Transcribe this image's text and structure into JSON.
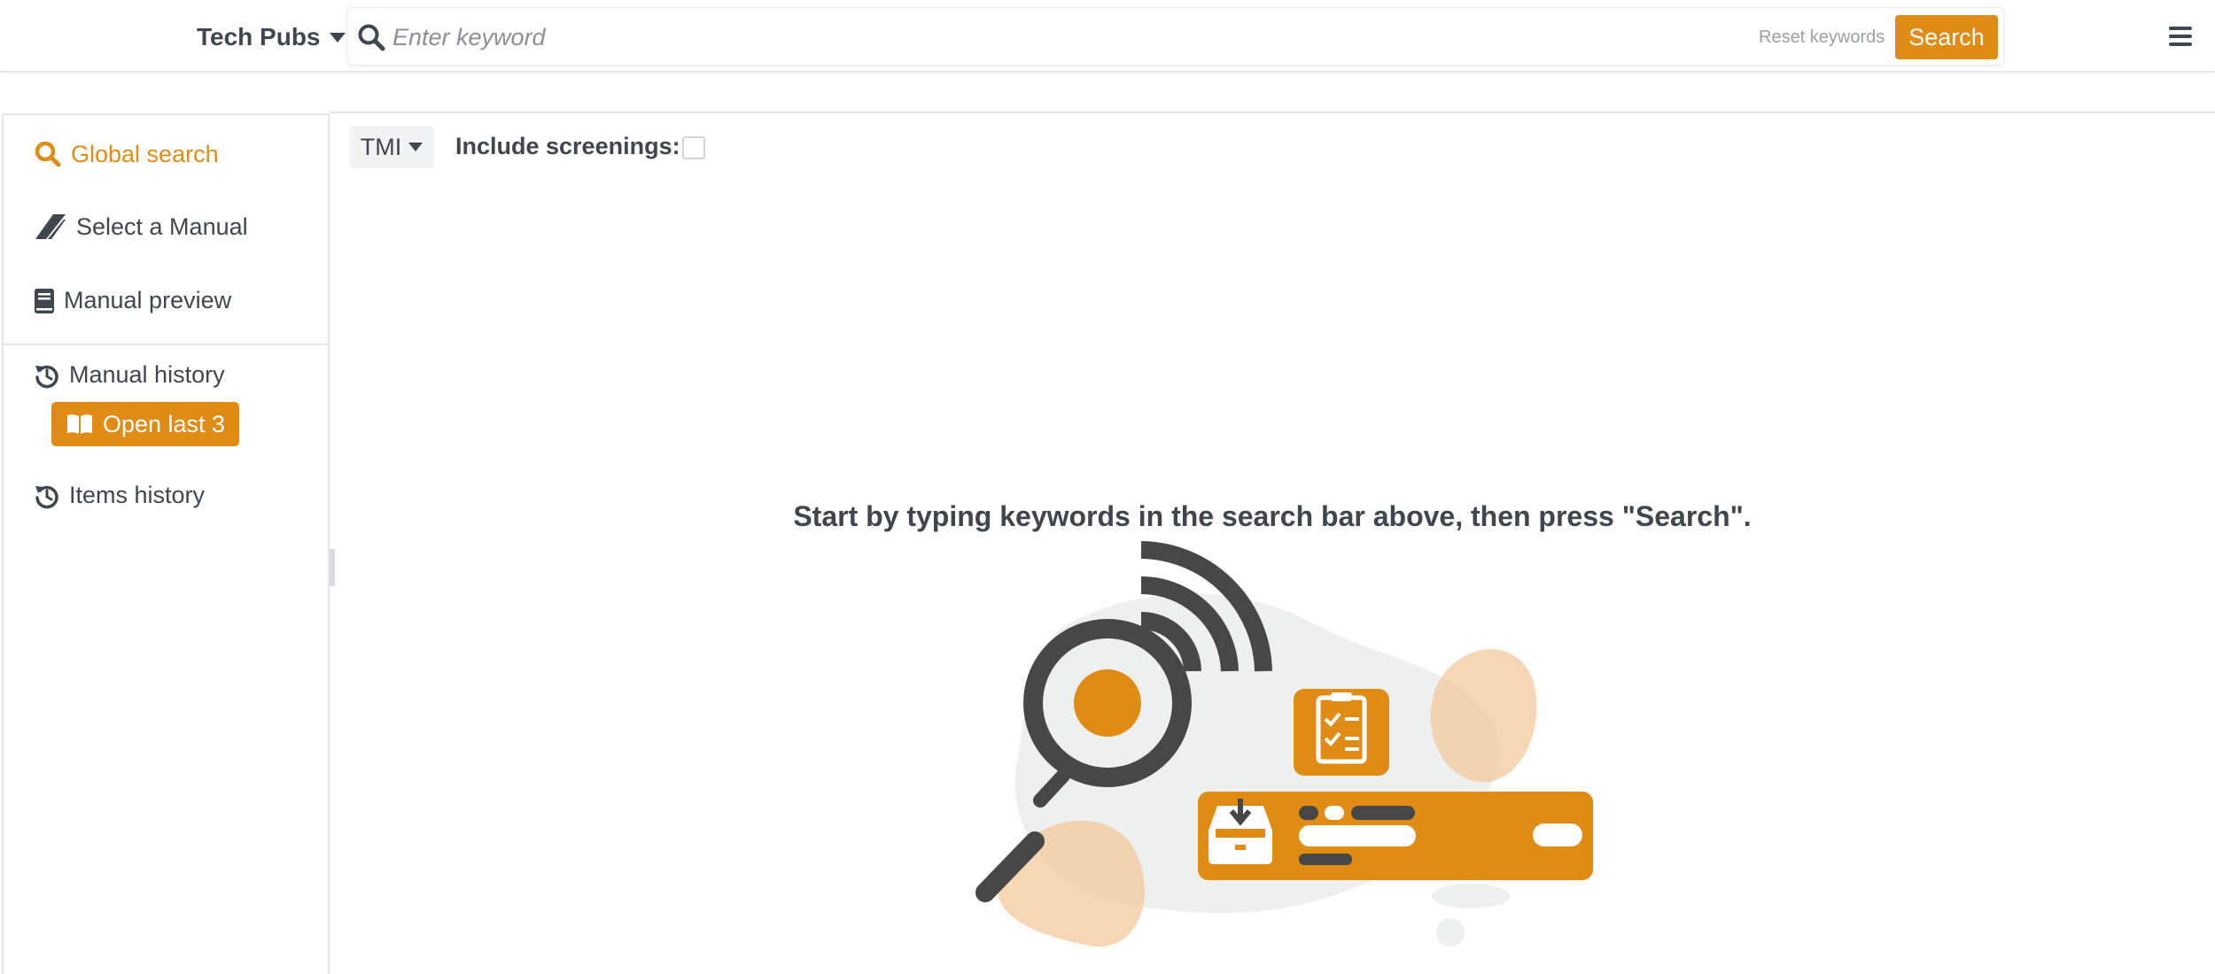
{
  "header": {
    "brand_label": "Tech Pubs",
    "search": {
      "placeholder": "Enter keyword",
      "value": "",
      "reset_label": "Reset keywords",
      "button_label": "Search"
    }
  },
  "sidebar": {
    "global_search_label": "Global search",
    "select_manual_label": "Select a Manual",
    "manual_preview_label": "Manual preview",
    "manual_history_label": "Manual history",
    "open_last_label": "Open last 3",
    "items_history_label": "Items history"
  },
  "toolbar": {
    "filter_label": "TMI",
    "include_screenings_label": "Include screenings:",
    "include_screenings_checked": false
  },
  "main": {
    "empty_message": "Start by typing keywords in the search bar above, then press \"Search\"."
  },
  "colors": {
    "accent": "#e08c14",
    "text": "#3f464d",
    "border": "#e3e6ea",
    "blob_light": "#f1c89c",
    "illustration_dark": "#474747"
  },
  "icons": {
    "search": "search-icon",
    "menu": "hamburger-menu-icon",
    "select_manual": "fighter-jet-icon",
    "manual_preview": "book-icon",
    "history": "history-icon",
    "open_book": "open-book-icon"
  }
}
